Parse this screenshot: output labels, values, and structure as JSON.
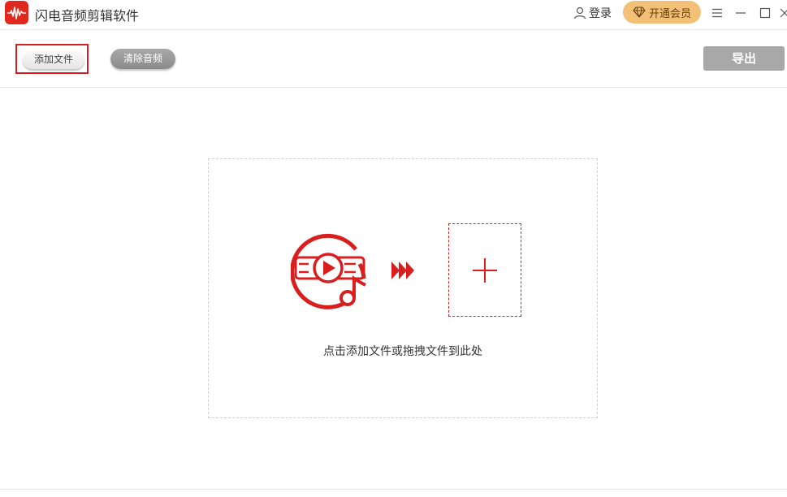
{
  "titlebar": {
    "app_title": "闪电音频剪辑软件",
    "login_label": "登录",
    "vip_label": "开通会员",
    "logo_color": "#e0281f",
    "vip_color": "#f2c077"
  },
  "toolbar": {
    "add_file_label": "添加文件",
    "clear_audio_label": "清除音频",
    "export_label": "导出",
    "highlight_color": "#d81e1e"
  },
  "drop_zone": {
    "hint": "点击添加文件或拖拽文件到此处",
    "accent_color": "#d81e1e"
  },
  "icons": {
    "logo": "waveform-icon",
    "login": "user-icon",
    "vip": "diamond-icon",
    "menu": "hamburger-menu-icon",
    "minimize": "minimize-icon",
    "maximize": "maximize-icon",
    "close": "close-icon",
    "music": "music-video-icon",
    "arrows": "fast-forward-arrows-icon",
    "plus": "plus-icon"
  }
}
